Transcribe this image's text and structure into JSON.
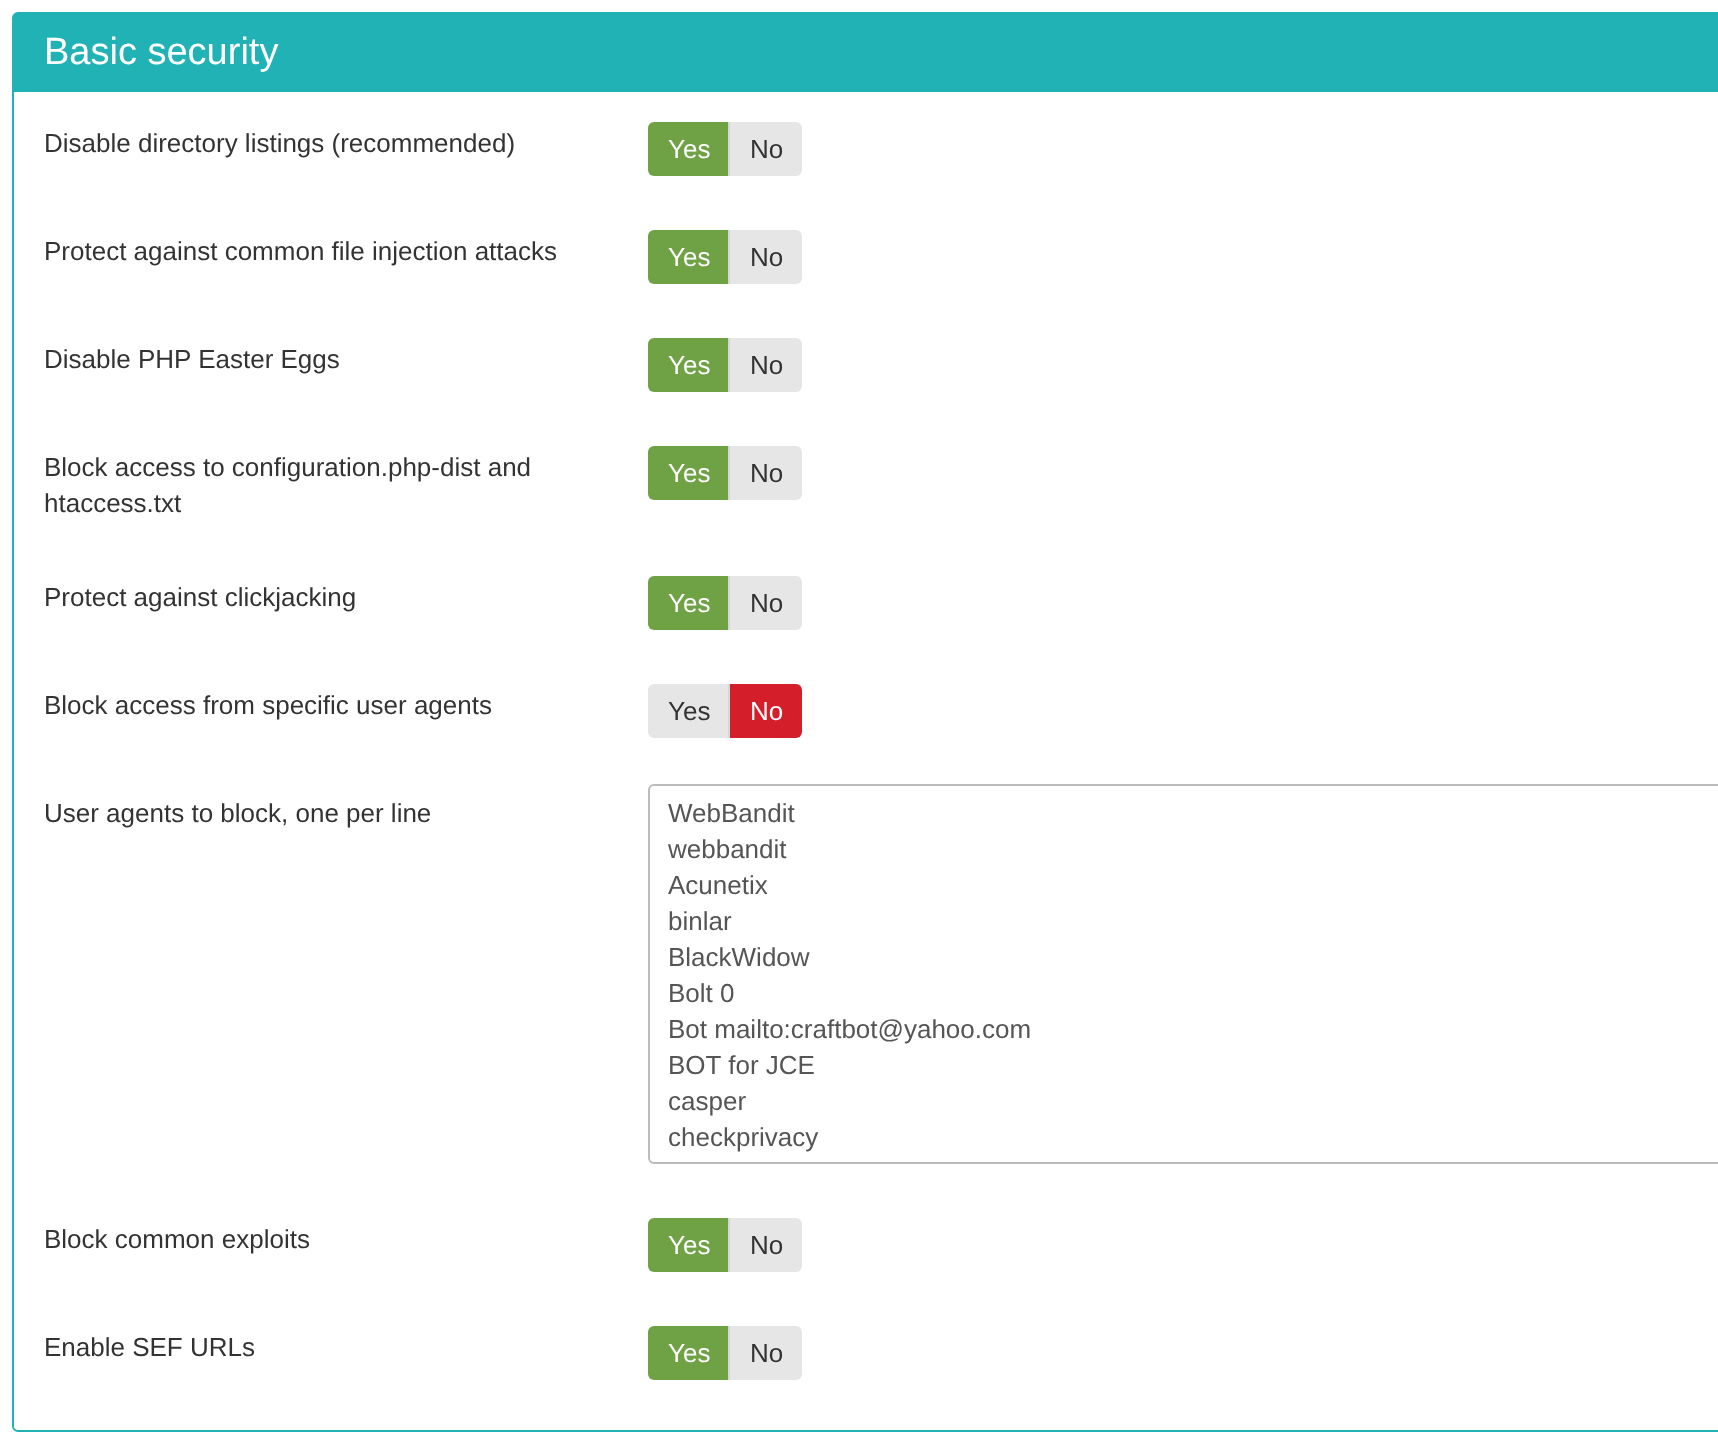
{
  "panel": {
    "title": "Basic security"
  },
  "rows": [
    {
      "kind": "toggle",
      "label": "Disable directory listings (recommended)",
      "options": [
        {
          "label": "Yes",
          "selected": true
        },
        {
          "label": "No",
          "selected": false
        }
      ]
    },
    {
      "kind": "toggle",
      "label": "Protect against common file injection attacks",
      "options": [
        {
          "label": "Yes",
          "selected": true
        },
        {
          "label": "No",
          "selected": false
        }
      ]
    },
    {
      "kind": "toggle",
      "label": "Disable PHP Easter Eggs",
      "options": [
        {
          "label": "Yes",
          "selected": true
        },
        {
          "label": "No",
          "selected": false
        }
      ]
    },
    {
      "kind": "toggle",
      "label": "Block access to configuration.php-dist and htaccess.txt",
      "options": [
        {
          "label": "Yes",
          "selected": true
        },
        {
          "label": "No",
          "selected": false
        }
      ]
    },
    {
      "kind": "toggle",
      "label": "Protect against clickjacking",
      "options": [
        {
          "label": "Yes",
          "selected": true
        },
        {
          "label": "No",
          "selected": false
        }
      ]
    },
    {
      "kind": "toggle",
      "label": "Block access from specific user agents",
      "options": [
        {
          "label": "Yes",
          "selected": false
        },
        {
          "label": "No",
          "selected": true
        }
      ]
    },
    {
      "kind": "textarea",
      "label": "User agents to block, one per line",
      "lines": [
        "WebBandit",
        "webbandit",
        "Acunetix",
        "binlar",
        "BlackWidow",
        "Bolt 0",
        "Bot mailto:craftbot@yahoo.com",
        "BOT for JCE",
        "casper",
        "checkprivacy"
      ]
    },
    {
      "kind": "toggle",
      "label": "Block common exploits",
      "options": [
        {
          "label": "Yes",
          "selected": true
        },
        {
          "label": "No",
          "selected": false
        }
      ]
    },
    {
      "kind": "toggle",
      "label": "Enable SEF URLs",
      "options": [
        {
          "label": "Yes",
          "selected": true
        },
        {
          "label": "No",
          "selected": false
        }
      ]
    }
  ]
}
